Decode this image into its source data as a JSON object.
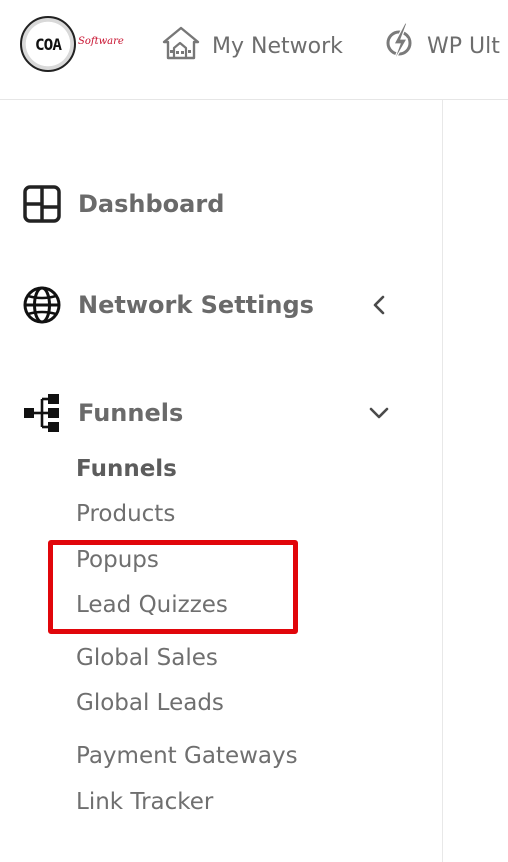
{
  "header": {
    "logo": {
      "text": "COA",
      "subtext": "Software"
    },
    "nav": [
      {
        "label": "My Network",
        "icon": "houses-icon"
      },
      {
        "label": "WP Ult",
        "icon": "lightning-bolt-icon"
      }
    ]
  },
  "sidebar": {
    "items": [
      {
        "label": "Dashboard",
        "icon": "dashboard-grid-icon"
      },
      {
        "label": "Network Settings",
        "icon": "globe-icon",
        "chevron": "chevron-left-icon"
      },
      {
        "label": "Funnels",
        "icon": "sitemap-icon",
        "chevron": "chevron-down-icon",
        "expanded": true
      }
    ],
    "funnels_submenu": [
      {
        "label": "Funnels",
        "active": true
      },
      {
        "label": "Products"
      },
      {
        "label": "Popups"
      },
      {
        "label": "Lead Quizzes"
      },
      {
        "label": "Global Sales",
        "highlighted": true
      },
      {
        "label": "Global Leads",
        "highlighted": true
      },
      {
        "label": "Payment Gateways"
      },
      {
        "label": "Link Tracker"
      }
    ]
  },
  "colors": {
    "highlight_border": "#e1060b",
    "text": "#6a6a6a",
    "logo_accent": "#c8102e"
  }
}
